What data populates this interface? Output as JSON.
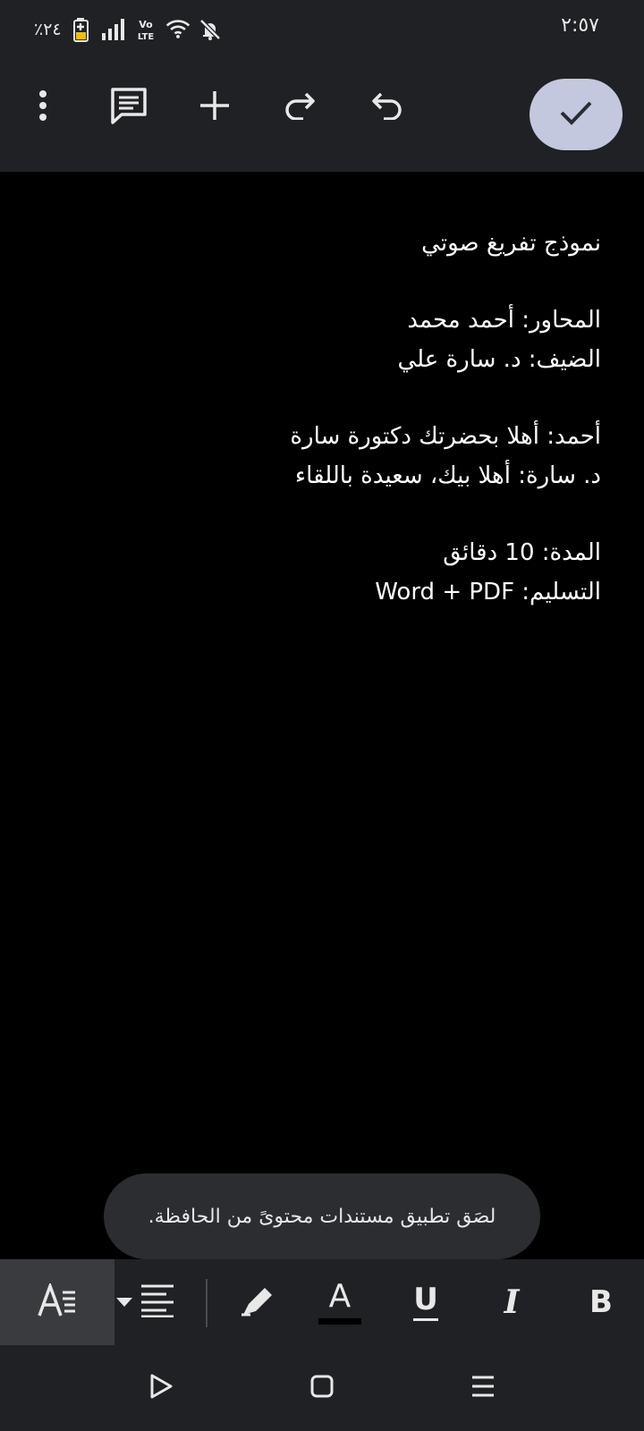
{
  "status_bar": {
    "time": "٢:٥٧",
    "battery_percent": "٪٢٤",
    "icons": [
      "battery-charging-icon",
      "signal-icon",
      "volte-icon",
      "wifi-icon",
      "notifications-off-icon"
    ]
  },
  "toolbar": {
    "icons": [
      "more-vert-icon",
      "comment-icon",
      "add-icon",
      "redo-icon",
      "undo-icon",
      "check-icon"
    ],
    "accent_color": "#c4c8de"
  },
  "document": {
    "title": "نموذج تفريغ صوتي",
    "interviewer": "المحاور: أحمد محمد",
    "guest": "الضيف: د. سارة علي",
    "line_ahmed": "أحمد: أهلا بحضرتك دكتورة سارة",
    "line_sara": "د. سارة: أهلا بيك، سعيدة باللقاء",
    "duration": "المدة: 10 دقائق",
    "delivery": "التسليم: Word + PDF"
  },
  "toast": {
    "text": "لصَق تطبيق مستندات محتوىً من الحافظة."
  },
  "format_bar": {
    "icons": [
      "text-style-icon",
      "align-dropdown-icon",
      "highlighter-icon",
      "text-color-icon",
      "underline-icon",
      "italic-icon",
      "bold-icon"
    ],
    "text_color_glyph": "A",
    "underline_glyph": "U",
    "italic_glyph": "I",
    "bold_glyph": "B"
  },
  "nav_bar": {
    "icons": [
      "back-icon",
      "home-icon",
      "recents-icon"
    ]
  }
}
